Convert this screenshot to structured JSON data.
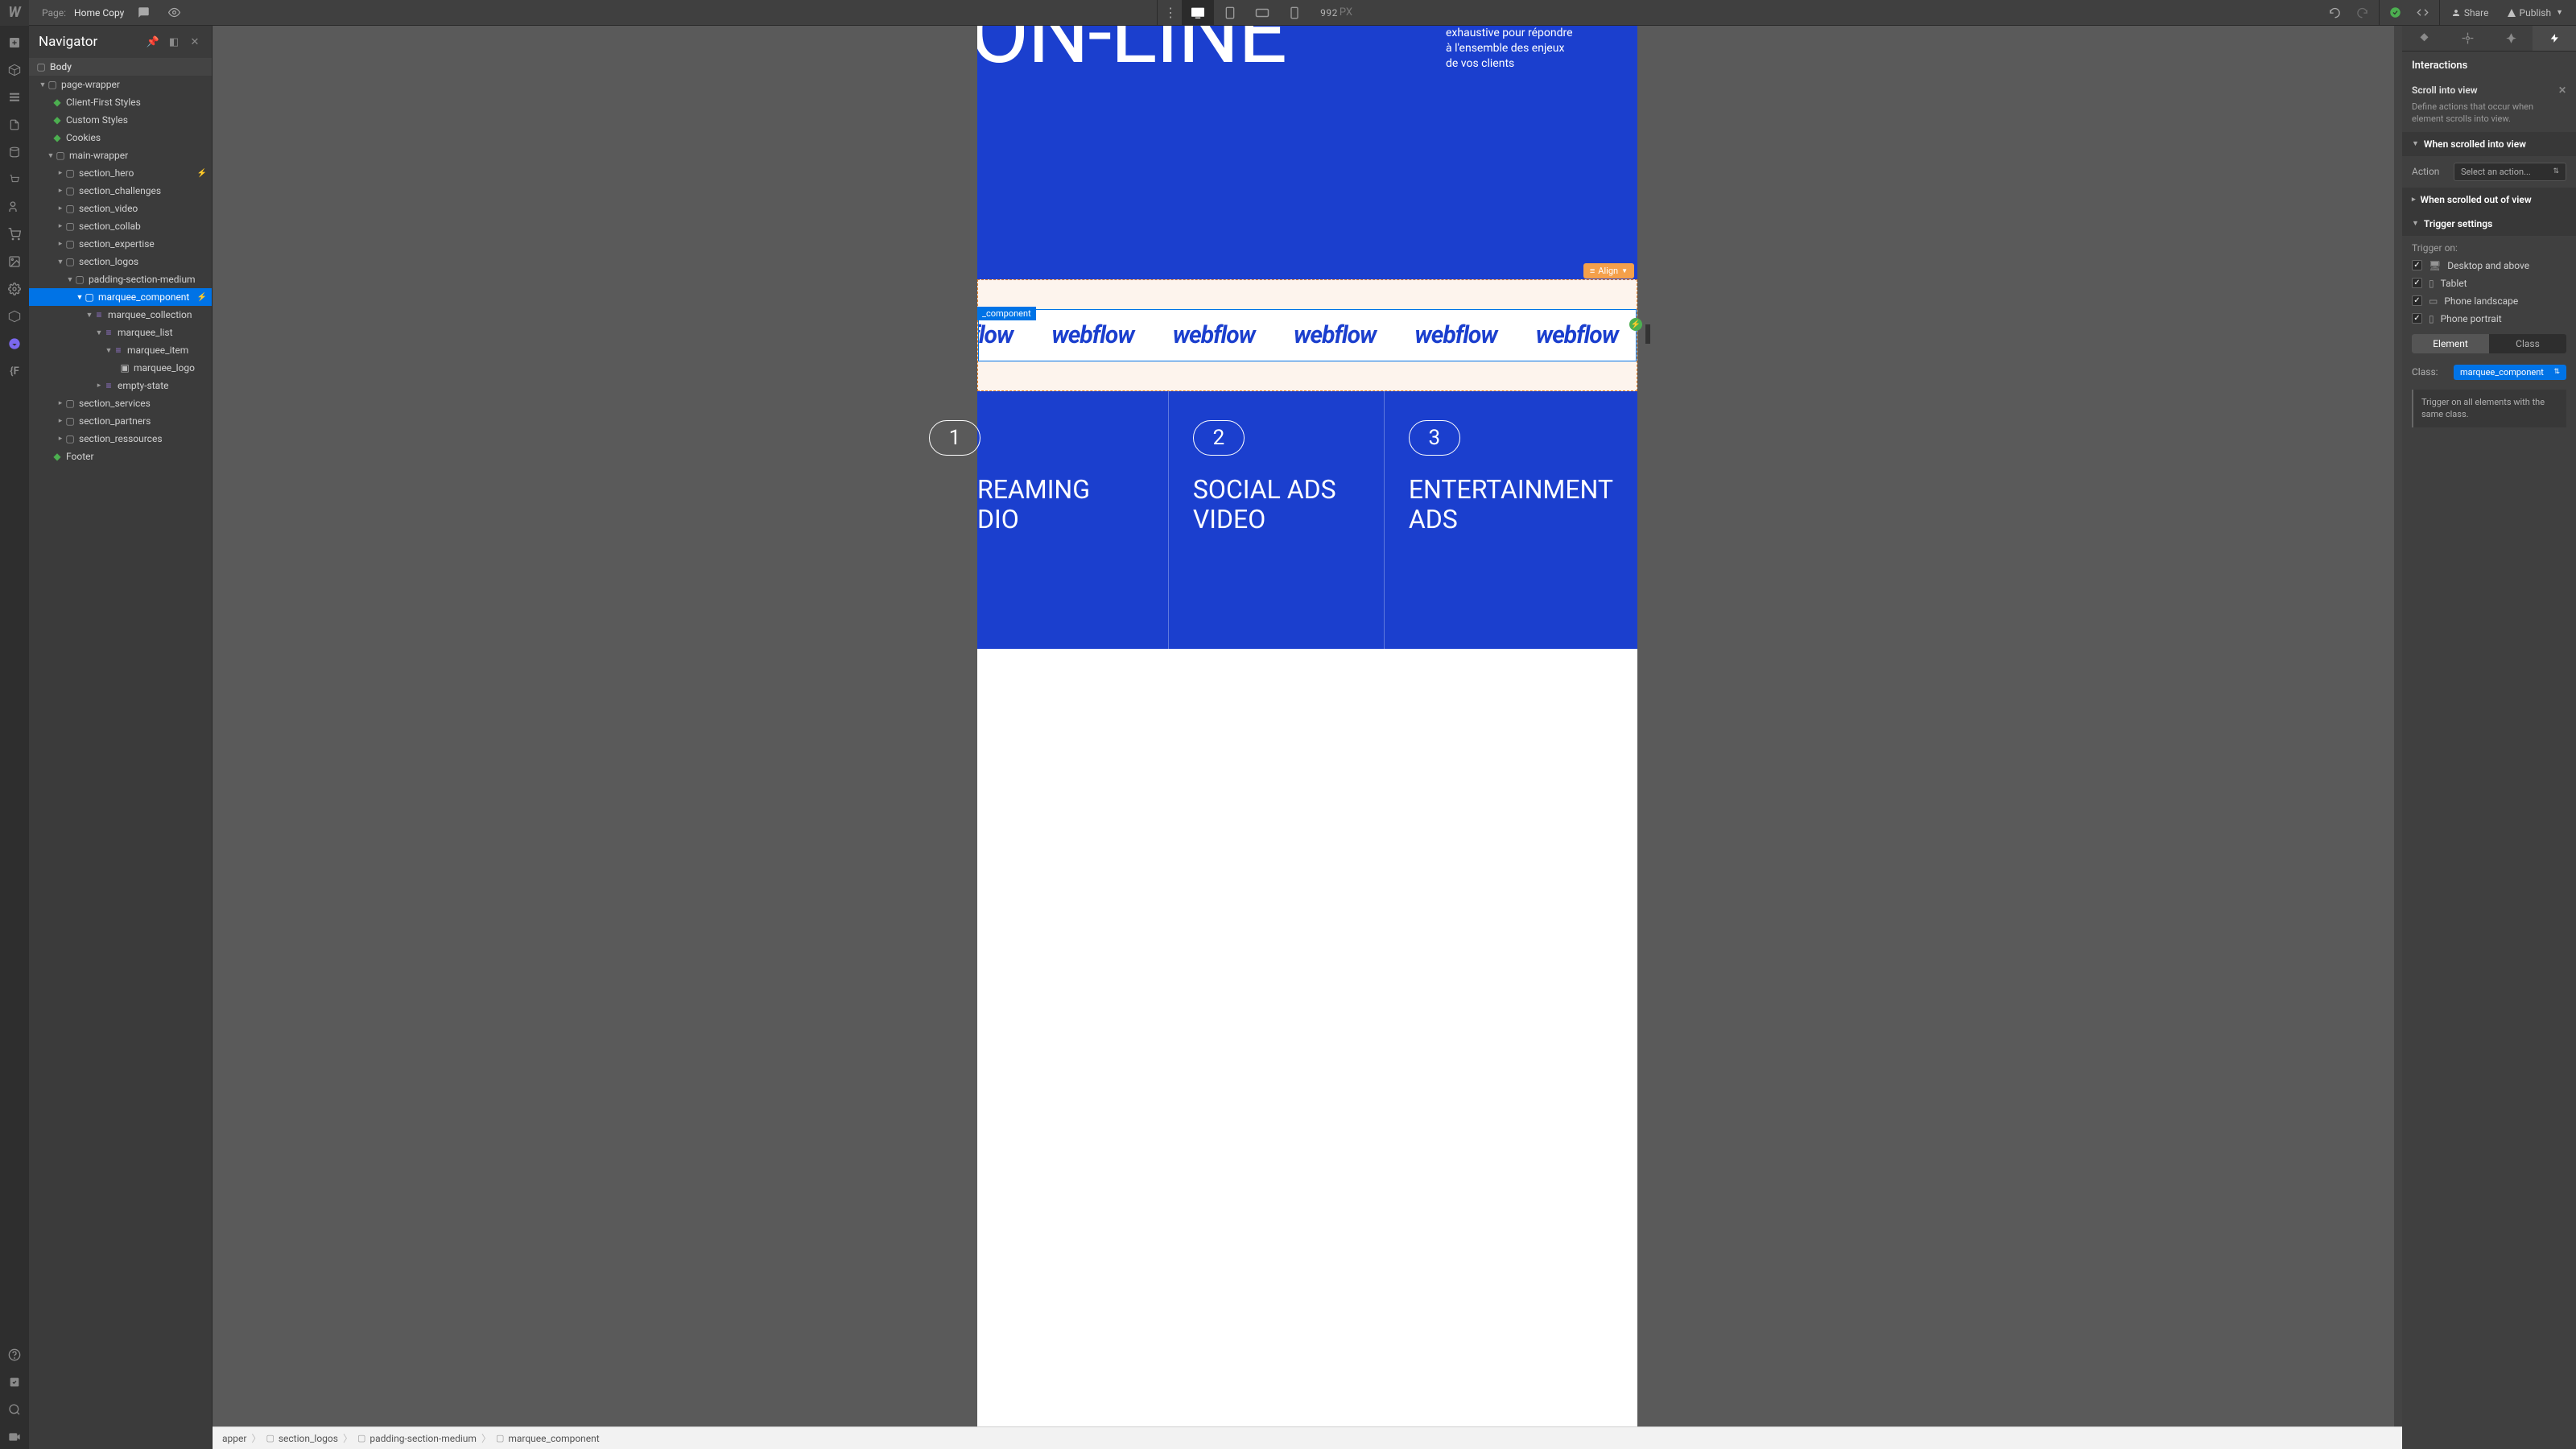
{
  "topbar": {
    "page_label": "Page:",
    "page_name": "Home Copy",
    "width_value": "992",
    "width_unit": "PX",
    "share": "Share",
    "publish": "Publish"
  },
  "navigator": {
    "title": "Navigator",
    "tree": {
      "body": "Body",
      "page_wrapper": "page-wrapper",
      "client_first": "Client-First Styles",
      "custom_styles": "Custom Styles",
      "cookies": "Cookies",
      "main_wrapper": "main-wrapper",
      "section_hero": "section_hero",
      "section_challenges": "section_challenges",
      "section_video": "section_video",
      "section_collab": "section_collab",
      "section_expertise": "section_expertise",
      "section_logos": "section_logos",
      "padding_section": "padding-section-medium",
      "marquee_component": "marquee_component",
      "marquee_collection": "marquee_collection",
      "marquee_list": "marquee_list",
      "marquee_item": "marquee_item",
      "marquee_logo": "marquee_logo",
      "empty_state": "empty-state",
      "section_services": "section_services",
      "section_partners": "section_partners",
      "section_ressources": "section_ressources",
      "footer": "Footer"
    }
  },
  "canvas": {
    "hero_title": "ON-LINE",
    "hero_copy_1": "exhaustive pour répondre",
    "hero_copy_2": "à l'ensemble des enjeux",
    "hero_copy_3": "de vos clients",
    "align_badge": "Align",
    "sel_tag": "_component",
    "marquee_text": "webflow",
    "services": [
      {
        "num": "1",
        "title_1": "REAMING",
        "title_2": "DIO"
      },
      {
        "num": "2",
        "title_1": "SOCIAL ADS",
        "title_2": "VIDEO"
      },
      {
        "num": "3",
        "title_1": "ENTERTAINMENT",
        "title_2": "ADS"
      }
    ]
  },
  "breadcrumb": {
    "c1": "apper",
    "c2": "section_logos",
    "c3": "padding-section-medium",
    "c4": "marquee_component"
  },
  "right": {
    "interactions_title": "Interactions",
    "scroll_into_view": "Scroll into view",
    "scroll_desc": "Define actions that occur when element scrolls into view.",
    "when_in": "When scrolled into view",
    "action_label": "Action",
    "action_placeholder": "Select an action...",
    "when_out": "When scrolled out of view",
    "trigger_settings": "Trigger settings",
    "trigger_on": "Trigger on:",
    "desktop": "Desktop and above",
    "tablet": "Tablet",
    "phone_l": "Phone landscape",
    "phone_p": "Phone portrait",
    "seg_element": "Element",
    "seg_class": "Class",
    "class_label": "Class:",
    "class_value": "marquee_component",
    "note": "Trigger on all elements with the same class."
  }
}
